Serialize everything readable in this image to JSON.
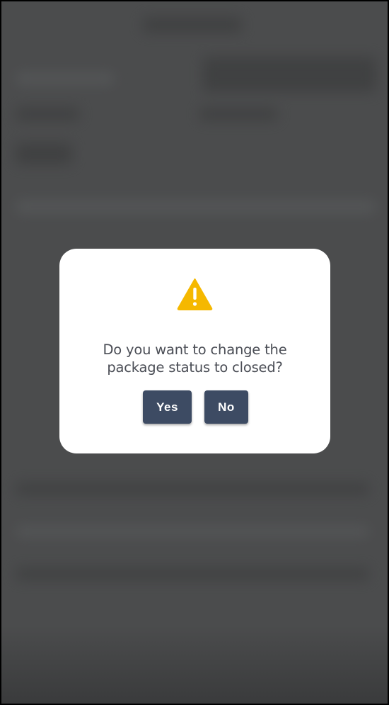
{
  "dialog": {
    "icon": "warning-icon",
    "icon_color": "#f5b800",
    "message": "Do you want to change the package status to closed?",
    "yes_label": "Yes",
    "no_label": "No",
    "button_color": "#3d4b63"
  }
}
